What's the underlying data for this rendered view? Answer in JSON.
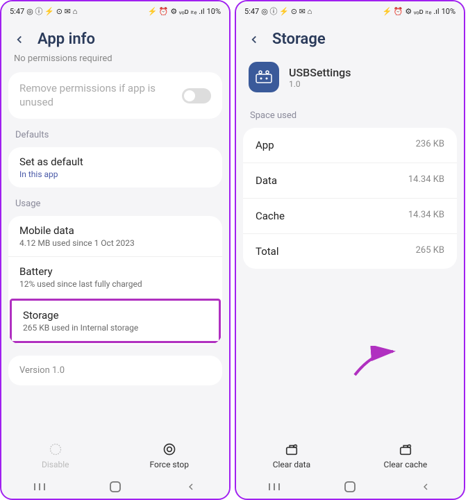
{
  "status": {
    "time": "5:47",
    "left_icons": "◎ ⓘ ⚡ ⊙ ✉ ⌂",
    "right_icons": "⚡ ⏰ ⚙ ᵥₒᴅ ₗₜₑ .ıl",
    "battery": "10%"
  },
  "left": {
    "title": "App info",
    "truncated": "No permissions required",
    "remove_perms": "Remove permissions if app is unused",
    "defaults_label": "Defaults",
    "set_default": {
      "title": "Set as default",
      "sub": "In this app"
    },
    "usage_label": "Usage",
    "mobile_data": {
      "title": "Mobile data",
      "sub": "4.12 MB used since 1 Oct 2023"
    },
    "battery": {
      "title": "Battery",
      "sub": "12% used since last fully charged"
    },
    "storage": {
      "title": "Storage",
      "sub": "265 KB used in Internal storage"
    },
    "version": "Version 1.0",
    "disable": "Disable",
    "force_stop": "Force stop"
  },
  "right": {
    "title": "Storage",
    "app_name": "USBSettings",
    "app_version": "1.0",
    "space_label": "Space used",
    "rows": {
      "app": {
        "key": "App",
        "val": "236 KB"
      },
      "data": {
        "key": "Data",
        "val": "14.34 KB"
      },
      "cache": {
        "key": "Cache",
        "val": "14.34 KB"
      },
      "total": {
        "key": "Total",
        "val": "265 KB"
      }
    },
    "clear_data": "Clear data",
    "clear_cache": "Clear cache"
  }
}
